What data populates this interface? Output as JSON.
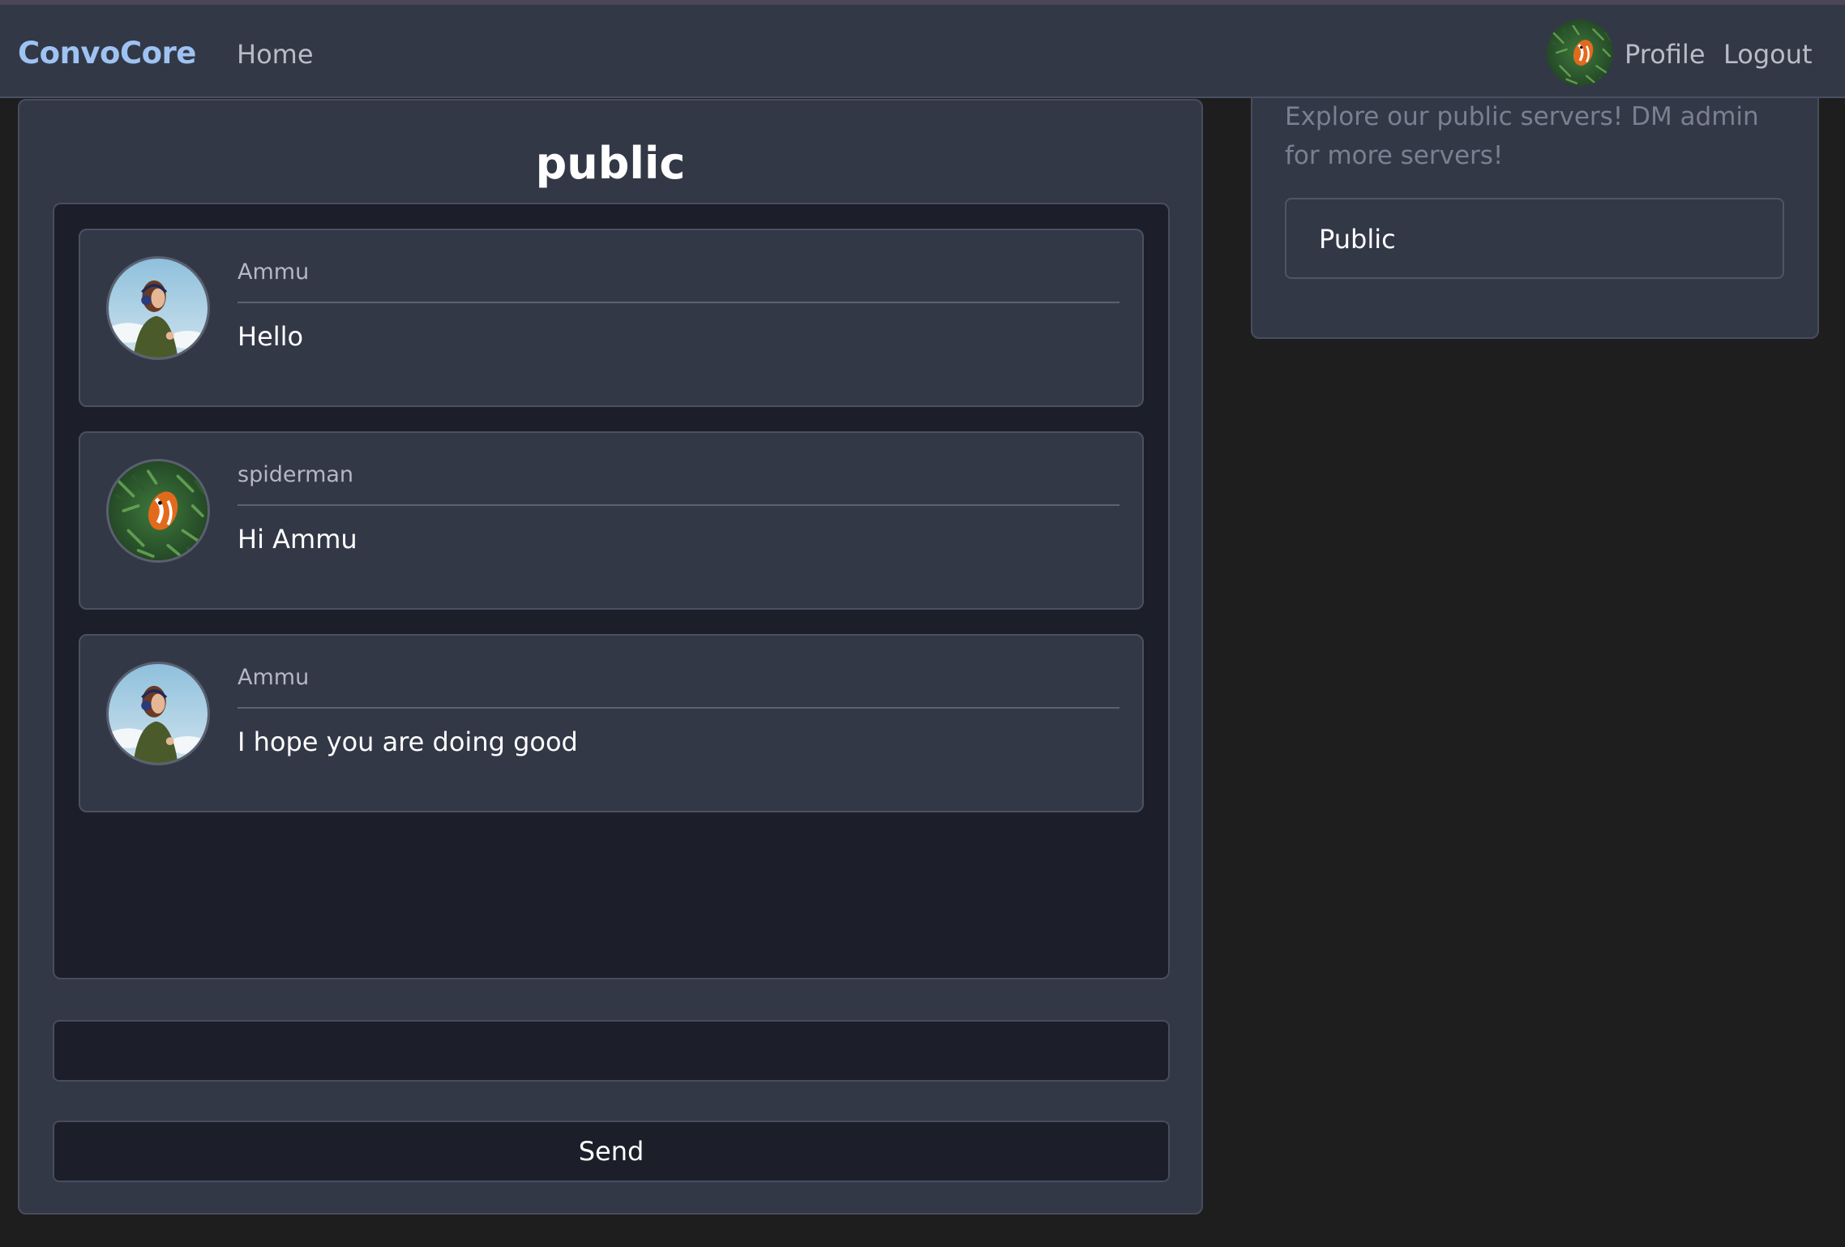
{
  "navbar": {
    "brand": "ConvoCore",
    "home_label": "Home",
    "profile_label": "Profile",
    "logout_label": "Logout",
    "avatar_icon": "clownfish-avatar-icon"
  },
  "chat": {
    "title": "public",
    "messages": [
      {
        "user": "Ammu",
        "text": "Hello",
        "avatar": "girl-avatar-icon"
      },
      {
        "user": "spiderman",
        "text": "Hi Ammu",
        "avatar": "clownfish-avatar-icon"
      },
      {
        "user": "Ammu",
        "text": "I hope you are doing good",
        "avatar": "girl-avatar-icon"
      }
    ],
    "input_value": "",
    "input_placeholder": "",
    "send_label": "Send"
  },
  "sidebar": {
    "description": "Explore our public servers! DM admin for more servers!",
    "servers": [
      {
        "label": "Public"
      }
    ]
  },
  "colors": {
    "background": "#1e1e1e",
    "panel": "#333847",
    "panel_dark": "#1c1f29",
    "brand": "#9ec3f2"
  }
}
